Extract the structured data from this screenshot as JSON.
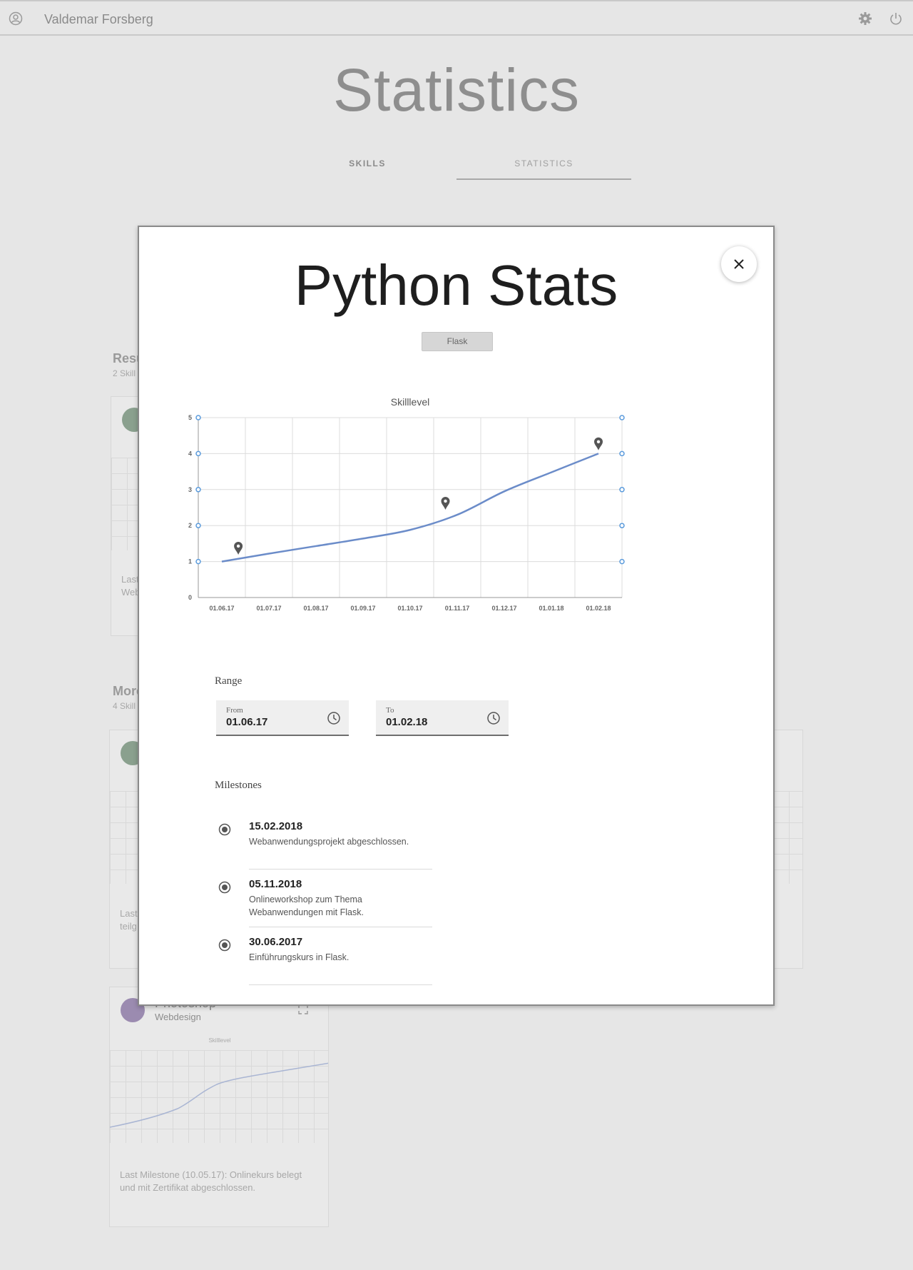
{
  "header": {
    "user_name": "Valdemar Forsberg"
  },
  "page": {
    "title": "Statistics",
    "tabs": [
      {
        "label": "SKILLS"
      },
      {
        "label": "STATISTICS"
      }
    ]
  },
  "background": {
    "section1": {
      "label": "Resu",
      "sub": "2 Skill"
    },
    "section2": {
      "label": "More",
      "sub": "4 Skill"
    },
    "card1_text": "Last\nWeb",
    "card2_text": "Last\nteilg",
    "photoshop_card": {
      "title": "Photoshop",
      "subtitle": "Webdesign",
      "chart_label": "Skilllevel",
      "milestone": "Last Milestone (10.05.17): Onlinekurs belegt und mit Zertifikat abgeschlossen."
    }
  },
  "modal": {
    "title": "Python Stats",
    "tag": "Flask",
    "range_label": "Range",
    "from_label": "From",
    "from_value": "01.06.17",
    "to_label": "To",
    "to_value": "01.02.18",
    "milestones_label": "Milestones",
    "milestones": [
      {
        "date": "15.02.2018",
        "desc": "Webanwendungsprojekt abgeschlossen."
      },
      {
        "date": "05.11.2018",
        "desc": "Onlineworkshop zum Thema Webanwendungen mit Flask."
      },
      {
        "date": "30.06.2017",
        "desc": "Einführungskurs in Flask."
      }
    ]
  },
  "chart_data": {
    "type": "line",
    "title": "Skilllevel",
    "categories": [
      "01.06.17",
      "01.07.17",
      "01.08.17",
      "01.09.17",
      "01.10.17",
      "01.11.17",
      "01.12.17",
      "01.01.18",
      "01.02.18"
    ],
    "series": [
      {
        "values": [
          1.0,
          1.22,
          1.43,
          1.64,
          1.88,
          2.3,
          2.95,
          3.48,
          4.0
        ],
        "color": "#6b8cc9"
      }
    ],
    "ylim": [
      0,
      5
    ],
    "yticks": [
      0,
      1,
      2,
      3,
      4,
      5
    ],
    "markers": [
      {
        "x_index": 0.35,
        "y": 1.35
      },
      {
        "x_index": 4.75,
        "y": 2.6
      },
      {
        "x_index": 8.0,
        "y": 4.25
      }
    ],
    "grid": true
  },
  "colors": {
    "line": "#6b8cc9",
    "handle": "#5b9bdc"
  }
}
